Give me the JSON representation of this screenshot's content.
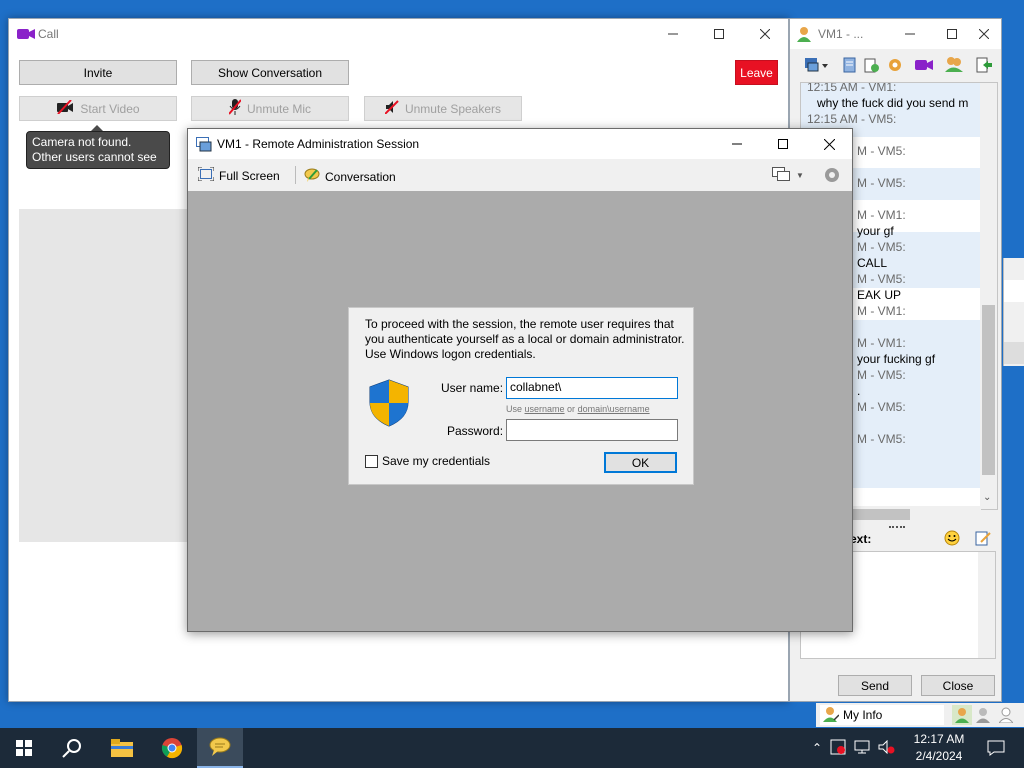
{
  "call_window": {
    "title": "Call",
    "buttons": {
      "invite": "Invite",
      "show_conversation": "Show Conversation",
      "leave": "Leave",
      "start_video": "Start Video",
      "unmute_mic": "Unmute Mic",
      "unmute_speakers": "Unmute Speakers"
    },
    "tooltip": {
      "line1": "Camera not found.",
      "line2": "Other users cannot see you."
    }
  },
  "chat_window": {
    "title": "VM1 - ...",
    "messages": [
      {
        "header": "12:15 AM - VM1:",
        "text": "why the fuck did you send m"
      },
      {
        "header": "12:15 AM - VM5:",
        "text": ""
      },
      {
        "header": "M - VM5:",
        "text": ""
      },
      {
        "header": "M - VM5:",
        "text": ""
      },
      {
        "header": "M - VM1:",
        "text": "your gf"
      },
      {
        "header": "M - VM5:",
        "text": "CALL"
      },
      {
        "header": "M - VM5:",
        "text": "EAK UP"
      },
      {
        "header": "M - VM1:",
        "text": ""
      },
      {
        "header": "M - VM1:",
        "text": "your fucking gf"
      },
      {
        "header": "M - VM5:",
        "text": "."
      },
      {
        "header": "M - VM5:",
        "text": ""
      },
      {
        "header": "M - VM5:",
        "text": ""
      }
    ],
    "compose_label": "ext:",
    "send": "Send",
    "close": "Close"
  },
  "remote_window": {
    "title": "VM1 - Remote Administration Session",
    "toolbar": {
      "full_screen": "Full Screen",
      "conversation": "Conversation"
    }
  },
  "auth_dialog": {
    "message": "To proceed with the session, the remote user requires that you authenticate yourself as a local or domain administrator. Use Windows logon credentials.",
    "username_label": "User name:",
    "username_value": "collabnet\\",
    "hint_prefix": "Use ",
    "hint_username": "username",
    "hint_middle": " or ",
    "hint_domain_username": "domain\\username",
    "password_label": "Password:",
    "password_value": "",
    "save_credentials": "Save my credentials",
    "save_checked": false,
    "ok": "OK"
  },
  "contacts_bar": {
    "my_info": "My Info"
  },
  "taskbar": {
    "time": "12:17 AM",
    "date": "2/4/2024",
    "apps": [
      "start",
      "search",
      "file-explorer",
      "chrome",
      "messenger"
    ]
  },
  "colors": {
    "desktop": "#1e6fc7",
    "leave_red": "#e81123",
    "dialog_bg": "#f0f0f0",
    "remote_bg": "#ababab",
    "taskbar": "#1c2a39"
  }
}
